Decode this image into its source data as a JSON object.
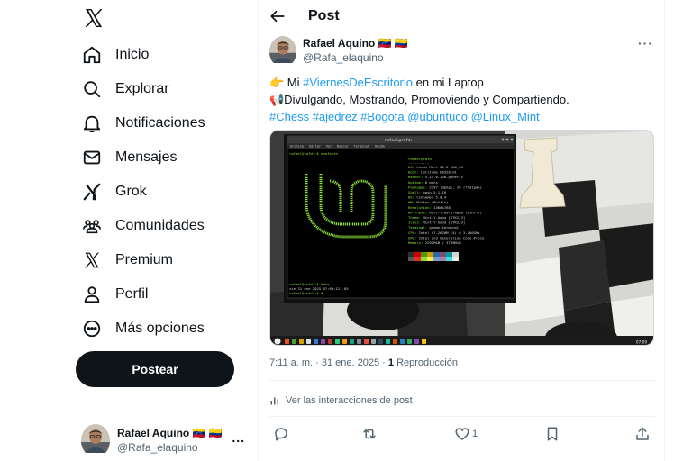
{
  "nav": {
    "items": [
      {
        "label": "Inicio",
        "icon": "home-icon"
      },
      {
        "label": "Explorar",
        "icon": "search-icon"
      },
      {
        "label": "Notificaciones",
        "icon": "bell-icon"
      },
      {
        "label": "Mensajes",
        "icon": "envelope-icon"
      },
      {
        "label": "Grok",
        "icon": "grok-icon"
      },
      {
        "label": "Comunidades",
        "icon": "people-icon"
      },
      {
        "label": "Premium",
        "icon": "x-logo-icon"
      },
      {
        "label": "Perfil",
        "icon": "person-icon"
      },
      {
        "label": "Más opciones",
        "icon": "more-circle-icon"
      }
    ],
    "post_button": "Postear"
  },
  "account": {
    "name": "Rafael Aquino 🇻🇪 🇨🇴",
    "handle": "@Rafa_elaquino",
    "more": "..."
  },
  "header": {
    "title": "Post"
  },
  "tweet": {
    "author_name": "Rafael Aquino 🇻🇪 🇨🇴",
    "author_handle": "@Rafa_elaquino",
    "more": "···",
    "line1_prefix": "👉 Mi ",
    "line1_link": "#ViernesDeEscritorio",
    "line1_suffix": " en mi Laptop",
    "line2": "📢Divulgando, Mostrando,  Promoviendo y Compartiendo.",
    "hashtags": [
      "#Chess",
      "#ajedrez",
      "#Bogota",
      "@ubuntuco",
      "@Linux_Mint"
    ],
    "time": "7:11 a. m.",
    "date": "31 ene. 2025",
    "views_count": "1",
    "views_label": "Reproducción",
    "interactions": "Ver las interacciones de post",
    "likes": "1"
  },
  "media": {
    "terminal_title": "rafael@rafd: ~",
    "menu": [
      "Archivo",
      "Editar",
      "Ver",
      "Buscar",
      "Terminal",
      "Ayuda"
    ],
    "prompt_cmd1": "rafael@rafd:~$ neofetch",
    "user_host": "rafael@rafd",
    "info": [
      "OS: Linux Mint 21.2 x86_64",
      "Host: Latitude E6320 01",
      "Kernel: 5.15.0-126-generic",
      "Uptime: 6 mins",
      "Packages: 2197 (dpkg), 39 (flatpak)",
      "Shell: bash 5.1.16",
      "DE: Cinnamon 5.8.4",
      "WM: Mutter (Muffin)",
      "Resolution: 1366x768",
      "WM Theme: Mint-Y-Dark-Aqua (Mint-Y)",
      "Theme: Mint-Y-Aqua [GTK2/3]",
      "Icons: Mint-Y-Sand [GTK2/3]",
      "Terminal: gnome-terminal",
      "CPU: Intel i7-2620M (4) @ 3.400GHz",
      "GPU: Intel 2nd Generation Core Proce",
      "Memory: 2292MiB / 3789MiB"
    ],
    "prompt_cmd2": "rafael@rafd:~$ date",
    "date_output": "vie 31 ene 2025 07:09:12 -05",
    "prompt_cmd3": "rafael@rafd:~$ ",
    "clock": "07:09",
    "palette": [
      "#2e2e2e",
      "#cc0000",
      "#4e9a06",
      "#c4a000",
      "#3465a4",
      "#75507b",
      "#06989a",
      "#d3d7cf",
      "#555753",
      "#ef2929",
      "#8ae234",
      "#fce94f",
      "#729fcf",
      "#ad7fa8",
      "#34e2e2",
      "#eeeeec"
    ]
  },
  "colors": {
    "accent": "#1d9bf0",
    "text": "#0f1419",
    "secondary": "#536471",
    "terminal_green": "#8ae234"
  }
}
